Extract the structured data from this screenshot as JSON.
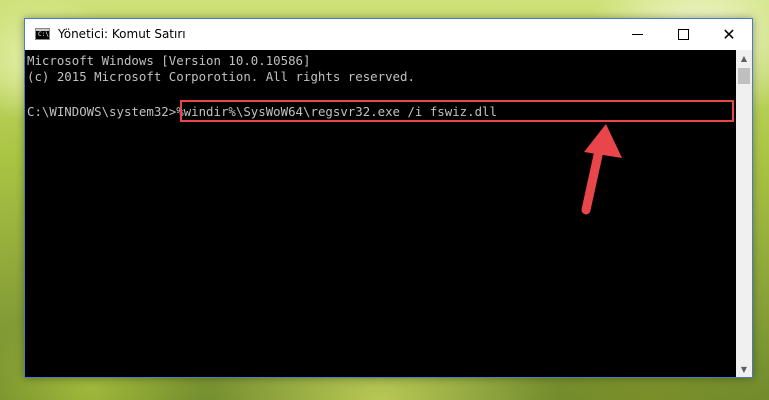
{
  "window": {
    "title": "Yönetici: Komut Satırı",
    "app_icon_text": "C:\\",
    "controls": {
      "minimize": "minimize-icon",
      "maximize": "maximize-icon",
      "close": "close-icon"
    }
  },
  "console": {
    "line1": "Microsoft Windows [Version 10.0.10586]",
    "line2": "(c) 2015 Microsoft Corporotion. All rights reserved.",
    "prompt": "C:\\WINDOWS\\system32>",
    "command": "%windir%\\SysWoW64\\regsvr32.exe /i fswiz.dll"
  },
  "colors": {
    "console_bg": "#000000",
    "console_text": "#c0c0c0",
    "highlight": "#e8464a"
  }
}
